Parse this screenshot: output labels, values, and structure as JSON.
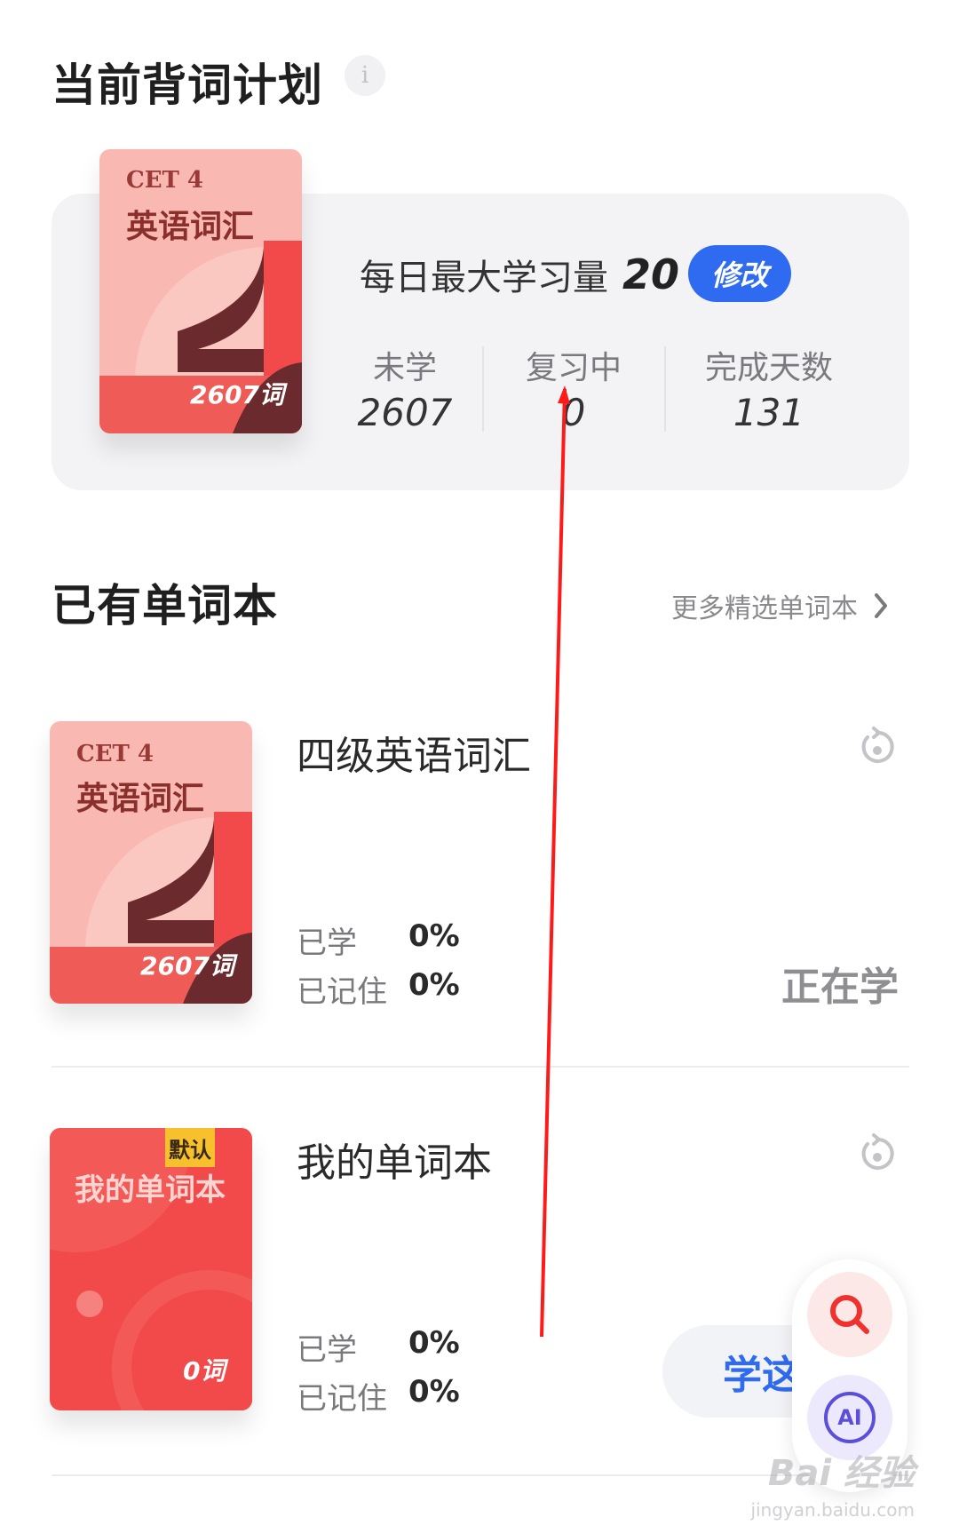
{
  "plan": {
    "title": "当前背词计划",
    "info_icon": "info-icon",
    "book_cover": {
      "line1": "CET 4",
      "line2": "英语词汇",
      "count": "2607词"
    },
    "daily_label": "每日最大学习量",
    "daily_value": "20",
    "edit_label": "修改",
    "stats": [
      {
        "label": "未学",
        "value": "2607"
      },
      {
        "label": "复习中",
        "value": "0"
      },
      {
        "label": "完成天数",
        "value": "131"
      }
    ]
  },
  "books_section": {
    "title": "已有单词本",
    "more_label": "更多精选单词本",
    "more_icon": "chevron-right-icon"
  },
  "books": [
    {
      "cover_line1": "CET 4",
      "cover_line2": "英语词汇",
      "cover_count": "2607词",
      "title": "四级英语词汇",
      "learned_label": "已学",
      "learned_value": "0%",
      "memorized_label": "已记住",
      "memorized_value": "0%",
      "status": "正在学",
      "action_icon": "reset-icon"
    },
    {
      "cover_badge": "默认",
      "cover_title": "我的单词本",
      "cover_count": "0词",
      "title": "我的单词本",
      "learned_label": "已学",
      "learned_value": "0%",
      "memorized_label": "已记住",
      "memorized_value": "0%",
      "action_label": "学这",
      "action_icon": "reset-icon"
    }
  ],
  "floating": {
    "search_icon": "search-icon",
    "ai_label": "AI"
  },
  "watermark": {
    "brand": "Bai 经验",
    "url": "jingyan.baidu.com"
  },
  "colors": {
    "accent": "#2f6bf0",
    "cover_pink": "#f9b3ac",
    "cover_red": "#f24a4a",
    "annotation_red": "#ff1a1a"
  }
}
